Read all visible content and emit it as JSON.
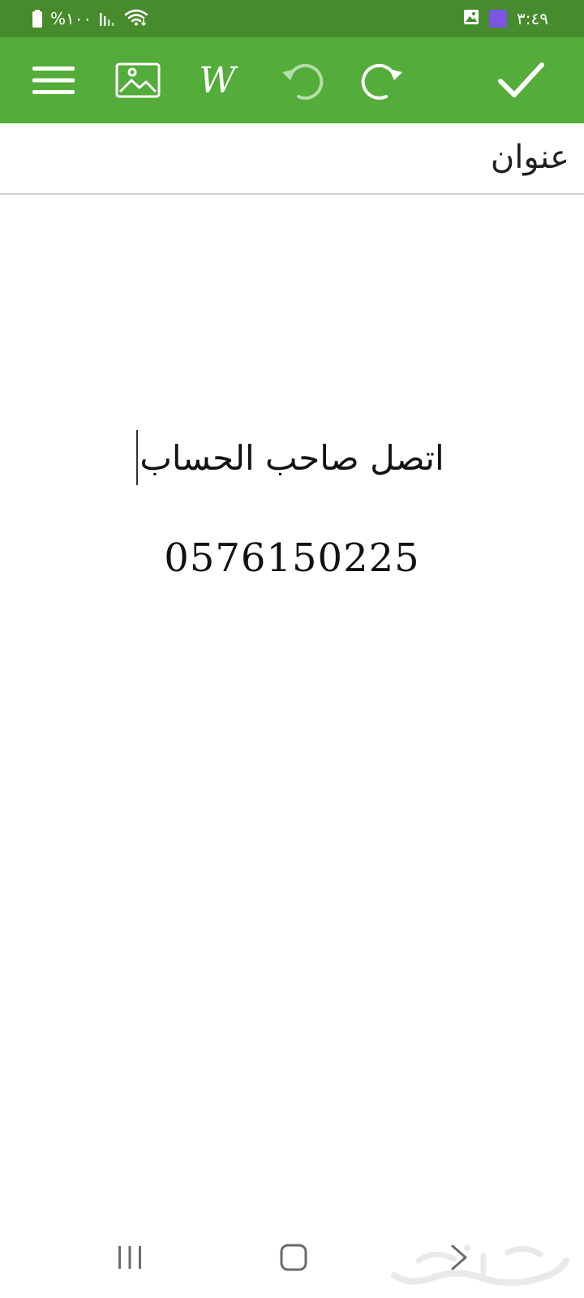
{
  "status_bar": {
    "battery_text": "%١٠٠",
    "time": "٣:٤٩",
    "icons": [
      "battery-icon",
      "signal-icon",
      "wifi-icon",
      "gallery-notification-icon",
      "app-notification-icon"
    ],
    "background_color": "#468b2c"
  },
  "toolbar": {
    "background_color": "#54ac3a",
    "items": [
      {
        "name": "menu",
        "icon": "hamburger-icon"
      },
      {
        "name": "insert-image",
        "icon": "image-icon"
      },
      {
        "name": "word-format",
        "icon": "w-icon",
        "label": "W"
      },
      {
        "name": "undo",
        "icon": "undo-icon",
        "enabled": false
      },
      {
        "name": "redo",
        "icon": "redo-icon",
        "enabled": true
      },
      {
        "name": "save",
        "icon": "checkmark-icon"
      }
    ]
  },
  "note": {
    "title_placeholder": "عنوان",
    "title_value": "",
    "body_line_1": "اتصل صاحب الحساب",
    "body_line_2": "0576150225"
  },
  "navbar": {
    "items": [
      "recent-apps-icon",
      "home-icon",
      "back-icon"
    ],
    "watermark": "حراج"
  }
}
